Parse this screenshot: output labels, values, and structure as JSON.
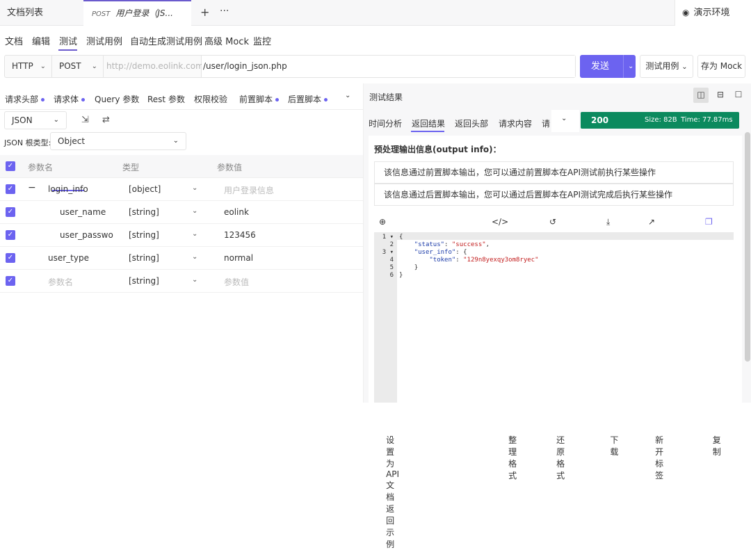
{
  "topbar": {
    "docs_tab": "文档列表",
    "active_tab_method": "POST",
    "active_tab_title": "用户登录（JS...",
    "env_label": "演示环境"
  },
  "subnav": [
    "文档",
    "编辑",
    "测试",
    "测试用例",
    "自动生成测试用例",
    "高级 Mock",
    "监控"
  ],
  "urlbar": {
    "protocol": "HTTP",
    "method": "POST",
    "host_placeholder": "http://demo.eolink.com",
    "path": "/user/login_json.php",
    "send": "发送",
    "cases": "测试用例",
    "save_mock": "存为 Mock"
  },
  "left_tabs": [
    "请求头部",
    "请求体",
    "Query 参数",
    "Rest 参数",
    "权限校验",
    "前置脚本",
    "后置脚本"
  ],
  "body_format": "JSON",
  "json_root_label": "JSON 根类型:",
  "json_root_value": "Object",
  "table": {
    "headers": [
      "参数名",
      "类型",
      "参数值"
    ],
    "rows": [
      {
        "name": "login_info",
        "type": "[object]",
        "value": "用户登录信息",
        "muted_value": true,
        "muted_name": false
      },
      {
        "name": "user_name",
        "type": "[string]",
        "value": "eolink",
        "muted_value": false,
        "muted_name": false
      },
      {
        "name": "user_passwo",
        "type": "[string]",
        "value": "123456",
        "muted_value": false,
        "muted_name": false
      },
      {
        "name": "user_type",
        "type": "[string]",
        "value": "normal",
        "muted_value": false,
        "muted_name": false
      },
      {
        "name": "参数名",
        "type": "[string]",
        "value": "参数值",
        "muted_value": true,
        "muted_name": true
      }
    ]
  },
  "result": {
    "title": "测试结果",
    "tabs": [
      "时间分析",
      "返回结果",
      "返回头部",
      "请求内容",
      "请"
    ],
    "status_code": "200",
    "size": "Size:  82B",
    "time": "Time:  77.87ms",
    "section_title": "预处理输出信息(output info)：",
    "notes": [
      "该信息通过前置脚本输出，您可以通过前置脚本在API测试前执行某些操作",
      "该信息通过后置脚本输出，您可以通过后置脚本在API测试完成后执行某些操作"
    ],
    "toolbar": [
      "设置为 API 文档返回示例",
      "整理格式",
      "还原格式",
      "下载",
      "新开标签",
      "复制"
    ]
  },
  "code_lines": [
    "1",
    "2",
    "3",
    "4",
    "5",
    "6"
  ],
  "code": {
    "l1": "{",
    "l2_key": "\"status\"",
    "l2_val": "\"success\"",
    "l3_key": "\"user_info\"",
    "l4_key": "\"token\"",
    "l4_val": "\"129n8yexqy3om8ryec\"",
    "l5": "}",
    "l6": "}"
  },
  "colors": {
    "accent": "#6c63f0",
    "status_green": "#0b8a5e"
  }
}
